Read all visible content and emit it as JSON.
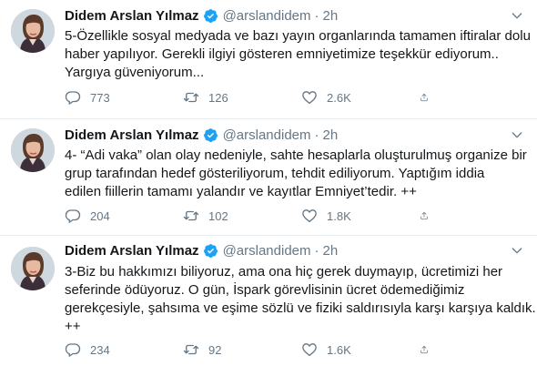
{
  "author": {
    "name": "Didem Arslan Yılmaz",
    "handle": "@arslandidem",
    "separator": "·"
  },
  "colors": {
    "verified": "#1da1f2",
    "muted": "#657786",
    "text": "#14171a",
    "divider": "#e6ecf0"
  },
  "tweets": [
    {
      "time": "2h",
      "lines": [
        "5-Özellikle sosyal medyada ve bazı yayın organlarında tamamen iftiralar dolu",
        "haber yapılıyor. Gerekli ilgiyi gösteren emniyetimize teşekkür ediyorum..",
        "Yargıya güveniyorum..."
      ],
      "replies": "773",
      "retweets": "126",
      "likes": "2.6K"
    },
    {
      "time": "2h",
      "lines": [
        "4- “Adi vaka” olan olay nedeniyle, sahte hesaplarla oluşturulmuş organize bir",
        "grup tarafından hedef gösteriliyorum, tehdit ediliyorum. Yaptığım iddia",
        "edilen fiillerin tamamı yalandır ve kayıtlar Emniyet’tedir. ++"
      ],
      "replies": "204",
      "retweets": "102",
      "likes": "1.8K"
    },
    {
      "time": "2h",
      "lines": [
        "3-Biz bu hakkımızı biliyoruz,  ama ona hiç gerek duymayıp, ücretimizi her",
        "seferinde ödüyoruz. O gün, İspark görevlisinin ücret ödemediğimiz",
        "gerekçesiyle, şahsıma ve eşime sözlü ve fiziki saldırısıyla karşı karşıya kaldık.",
        "++"
      ],
      "replies": "234",
      "retweets": "92",
      "likes": "1.6K"
    }
  ]
}
